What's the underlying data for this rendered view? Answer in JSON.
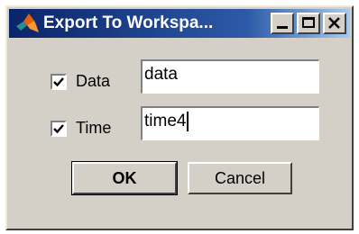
{
  "window": {
    "title": "Export To Workspa...",
    "title_bar_color": "#0a246a",
    "background_color": "#d4d0c8",
    "icon": "matlab-logo-icon"
  },
  "title_buttons": {
    "minimize_icon": "minimize-icon",
    "maximize_icon": "maximize-icon",
    "close_icon": "close-icon"
  },
  "fields": [
    {
      "label": "Data",
      "checked": true,
      "value": "data"
    },
    {
      "label": "Time",
      "checked": true,
      "value": "time4"
    }
  ],
  "buttons": {
    "ok_label": "OK",
    "cancel_label": "Cancel"
  }
}
